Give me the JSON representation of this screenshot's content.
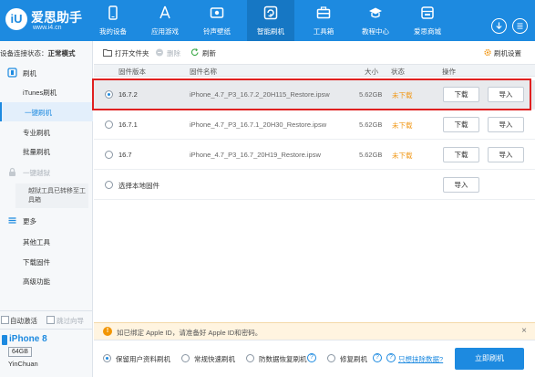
{
  "app": {
    "logo_title": "爱思助手",
    "logo_sub": "www.i4.cn",
    "brand_color": "#1d8ae0"
  },
  "nav": [
    {
      "label": "我的设备",
      "icon": "device-icon",
      "active": false
    },
    {
      "label": "应用游戏",
      "icon": "apps-icon",
      "active": false
    },
    {
      "label": "铃声壁纸",
      "icon": "ringtone-icon",
      "active": false
    },
    {
      "label": "智能刷机",
      "icon": "flash-icon",
      "active": true
    },
    {
      "label": "工具箱",
      "icon": "toolbox-icon",
      "active": false
    },
    {
      "label": "教程中心",
      "icon": "tutorial-icon",
      "active": false
    },
    {
      "label": "爱思商城",
      "icon": "store-icon",
      "active": false
    }
  ],
  "sidebar": {
    "status_prefix": "设备连接状态：",
    "status_value": "正常模式",
    "flash_section": "刷机",
    "items": [
      "iTunes刷机",
      "一键刷机",
      "专业刷机",
      "批量刷机"
    ],
    "jailbreak_section": "一键越狱",
    "jailbreak_note": "越狱工具已转移至工具箱",
    "more_section": "更多",
    "more_items": [
      "其他工具",
      "下载固件",
      "高级功能"
    ],
    "auto_activate": "自动激活",
    "skip_guide": "跳过向导"
  },
  "device": {
    "name": "iPhone 8",
    "capacity": "64GB",
    "owner": "YinChuan"
  },
  "toolbar": {
    "open_folder": "打开文件夹",
    "delete": "删除",
    "refresh": "刷新",
    "flash_settings": "刷机设置"
  },
  "table": {
    "headers": {
      "version": "固件版本",
      "name": "固件名称",
      "size": "大小",
      "status": "状态",
      "action": "操作"
    },
    "rows": [
      {
        "version": "16.7.2",
        "name": "iPhone_4.7_P3_16.7.2_20H115_Restore.ipsw",
        "size": "5.62GB",
        "status": "未下载",
        "download": "下载",
        "import": "导入",
        "selected": true
      },
      {
        "version": "16.7.1",
        "name": "iPhone_4.7_P3_16.7.1_20H30_Restore.ipsw",
        "size": "5.62GB",
        "status": "未下载",
        "download": "下载",
        "import": "导入",
        "selected": false
      },
      {
        "version": "16.7",
        "name": "iPhone_4.7_P3_16.7_20H19_Restore.ipsw",
        "size": "5.62GB",
        "status": "未下载",
        "download": "下载",
        "import": "导入",
        "selected": false
      }
    ],
    "local_row": {
      "label": "选择本地固件",
      "import": "导入"
    }
  },
  "notice": {
    "text": "如已绑定 Apple ID，请准备好 Apple ID和密码。"
  },
  "options": {
    "keep_data": "保留用户资料刷机",
    "quick": "常规快速刷机",
    "anti_recovery": "防数据恢复刷机",
    "repair": "修复刷机",
    "erase_link": "只想抹除数据?",
    "start_button": "立即刷机"
  }
}
